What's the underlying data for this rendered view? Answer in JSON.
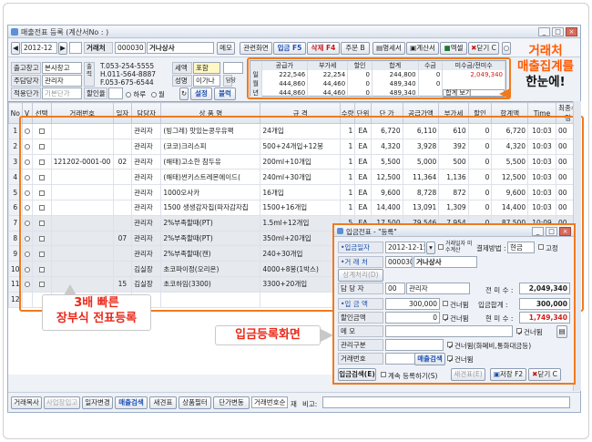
{
  "window": {
    "title": "매출전표 등록 (계산서No : )",
    "controls": [
      "_",
      "□",
      "×"
    ]
  },
  "toolbar": {
    "date": "2012-12",
    "date_day": "",
    "trade_label": "거래처",
    "trade_code": "000030",
    "trade_name": "거나상사",
    "memo_label": "메모",
    "buttons": [
      "관련화면",
      "입금 F5",
      "삭제 F4",
      "주문 B",
      "명세서",
      "계산서",
      "엑셀",
      "닫기 C"
    ]
  },
  "info": {
    "warehouse_label": "출고창고",
    "warehouse_value": "본사창고",
    "manager_label": "주담당자",
    "manager_value": "관리자",
    "price_label": "적용단가",
    "price_value": "기본단가",
    "discount_label": "할인율",
    "discount_value": "",
    "side_label": "출력",
    "tel": "T.053-254-5555",
    "hp": "H.011-564-8887",
    "fax": "F.053-675-6544",
    "type_label": "세액",
    "type_value": "포함",
    "desc_label": "성명",
    "desc_value": "이가나",
    "person_label": "담당",
    "person_value": "",
    "radio_next": "하루",
    "radio_month": "월",
    "settings_btn": "설정",
    "block_btn": "블럭"
  },
  "summary": {
    "headers": [
      "",
      "공급가",
      "부가세",
      "할인",
      "합계",
      "수금",
      "미수금/전미수"
    ],
    "rows": [
      {
        "label": "일",
        "cells": [
          "222,546",
          "22,254",
          "0",
          "244,800",
          "0",
          "2,049,340"
        ]
      },
      {
        "label": "월",
        "cells": [
          "444,860",
          "44,460",
          "0",
          "489,340",
          "0",
          ""
        ]
      },
      {
        "label": "년",
        "cells": [
          "444,860",
          "44,460",
          "0",
          "489,340",
          "",
          ""
        ]
      }
    ],
    "view_select": "합계 보기"
  },
  "callout": {
    "line1": "거래처",
    "line2": "매출집계를",
    "line3": "한눈에!"
  },
  "grid": {
    "headers": [
      "No",
      "V",
      "선택",
      "거래번호",
      "일자",
      "담당자",
      "상 품 명",
      "규 격",
      "수량",
      "단위",
      "단 가",
      "공급가액",
      "부가세",
      "할인",
      "합계액",
      "Time",
      "최종수정"
    ],
    "rows": [
      {
        "no": "1",
        "trade_no": "",
        "day": "",
        "manager": "관리자",
        "product": "(빙그레) 맛있는콩우유팩",
        "spec": "24개입",
        "qty": "1",
        "unit": "EA",
        "price": "6,720",
        "supply": "6,110",
        "vat": "610",
        "discount": "0",
        "total": "6,720",
        "time": "10:03",
        "mod": "00"
      },
      {
        "no": "2",
        "trade_no": "",
        "day": "",
        "manager": "관리자",
        "product": "(코코)크리스피",
        "spec": "500+24개입+12봉",
        "qty": "1",
        "unit": "EA",
        "price": "4,320",
        "supply": "3,928",
        "vat": "392",
        "discount": "0",
        "total": "4,320",
        "time": "10:03",
        "mod": "00"
      },
      {
        "no": "3",
        "trade_no": "121202-0001-00",
        "day": "02",
        "manager": "관리자",
        "product": "(해태)고소한 참두유",
        "spec": "200ml+10개입",
        "qty": "1",
        "unit": "EA",
        "price": "5,500",
        "supply": "5,000",
        "vat": "500",
        "discount": "0",
        "total": "5,500",
        "time": "10:03",
        "mod": "00"
      },
      {
        "no": "4",
        "trade_no": "",
        "day": "",
        "manager": "관리자",
        "product": "(해태)썬키스트레몬에이드(",
        "spec": "240ml+30개입",
        "qty": "1",
        "unit": "EA",
        "price": "12,500",
        "supply": "11,364",
        "vat": "1,136",
        "discount": "0",
        "total": "12,500",
        "time": "10:03",
        "mod": "00"
      },
      {
        "no": "5",
        "trade_no": "",
        "day": "",
        "manager": "관리자",
        "product": "1000오사카",
        "spec": "16개입",
        "qty": "1",
        "unit": "EA",
        "price": "9,600",
        "supply": "8,728",
        "vat": "872",
        "discount": "0",
        "total": "9,600",
        "time": "10:03",
        "mod": "00"
      },
      {
        "no": "6",
        "trade_no": "",
        "day": "",
        "manager": "관리자",
        "product": "1500 생생감자칩(파자감자칩",
        "spec": "1500+16개입",
        "qty": "1",
        "unit": "EA",
        "price": "14,400",
        "supply": "13,091",
        "vat": "1,309",
        "discount": "0",
        "total": "14,400",
        "time": "10:03",
        "mod": "00"
      },
      {
        "no": "7",
        "trade_no": "",
        "day": "",
        "manager": "관리자",
        "product": "2%부족할때(PT)",
        "spec": "1.5ml+12개입",
        "qty": "5",
        "unit": "EA",
        "price": "17,500",
        "supply": "79,546",
        "vat": "7,954",
        "discount": "0",
        "total": "87,500",
        "time": "10:09",
        "mod": "00"
      },
      {
        "no": "8",
        "trade_no": "",
        "day": "07",
        "manager": "관리자",
        "product": "2%부족할때(PT)",
        "spec": "350ml+20개입",
        "qty": "2",
        "unit": "EA",
        "price": "",
        "supply": "",
        "vat": "",
        "discount": "",
        "total": "",
        "time": "",
        "mod": ""
      },
      {
        "no": "9",
        "trade_no": "",
        "day": "",
        "manager": "관리자",
        "product": "2%부족할때(캔)",
        "spec": "240+30개입",
        "qty": "2",
        "unit": "EA",
        "price": "",
        "supply": "",
        "vat": "",
        "discount": "",
        "total": "",
        "time": "",
        "mod": ""
      },
      {
        "no": "10",
        "trade_no": "",
        "day": "",
        "manager": "김실장",
        "product": "초코파이정(오리온)",
        "spec": "4000+8봉(1박스)",
        "qty": "4",
        "unit": "EA",
        "price": "",
        "supply": "",
        "vat": "",
        "discount": "",
        "total": "",
        "time": "",
        "mod": ""
      },
      {
        "no": "11",
        "trade_no": "",
        "day": "15",
        "manager": "김실장",
        "product": "초코하임(3300)",
        "spec": "3300+20개입",
        "qty": "4",
        "unit": "EA",
        "price": "",
        "supply": "",
        "vat": "",
        "discount": "",
        "total": "",
        "time": "",
        "mod": ""
      },
      {
        "no": "12",
        "trade_no": "",
        "day": "",
        "manager": "",
        "product": "",
        "spec": "",
        "qty": "",
        "unit": "",
        "price": "",
        "supply": "",
        "vat": "",
        "discount": "",
        "total": "",
        "time": "",
        "mod": ""
      }
    ]
  },
  "annotations": {
    "fast_entry_line1": "3배 빠른",
    "fast_entry_line2": "장부식 전표등록",
    "deposit_screen": "입금등록화면"
  },
  "dialog": {
    "title": "입금전표 - \"등록\"",
    "date_label": "•입금일자",
    "date_value": "2012-12-15",
    "check_label": "거래일자 미수계산",
    "settle_label": "결제방법 :",
    "settle_value": "현금",
    "fixed_label": "고정",
    "trade_label": "•거 래 처",
    "trade_code": "000030",
    "trade_name": "거나상사",
    "upper_btn": "상계처리(D)",
    "manager_label": "담 당 자",
    "manager_code": "00",
    "manager_name": "관리자",
    "prev_due_label": "전 미 수 :",
    "prev_due_value": "2,049,340",
    "amount_label": "•입 금 액",
    "amount_value": "300,000",
    "skip_label": "건너뜀",
    "total_label": "입금합계 :",
    "total_value": "300,000",
    "discount_label": "할인금액",
    "discount_value": "0",
    "due_label": "현 미 수 :",
    "due_value": "1,749,340",
    "memo_label": "메 모",
    "category_label": "관리구분",
    "category_note": "건너뜀(화폐비,통화대금등)",
    "tradeno_label": "거래번호",
    "lookup_btn": "매출검색",
    "save_btn": "입금검색(E)",
    "continue_label": "계속 등록하기(S)",
    "new_btn": "새견표(E)",
    "store_btn": "저장 F2",
    "close_btn": "닫기 C"
  },
  "bottom": {
    "buttons": [
      "거래복사",
      "사업장입고",
      "일자변경",
      "매출검색",
      "새견표",
      "상품필터",
      "단가변동",
      "거래번호순"
    ],
    "ledger_label": "재",
    "memo_label": "비고:"
  }
}
